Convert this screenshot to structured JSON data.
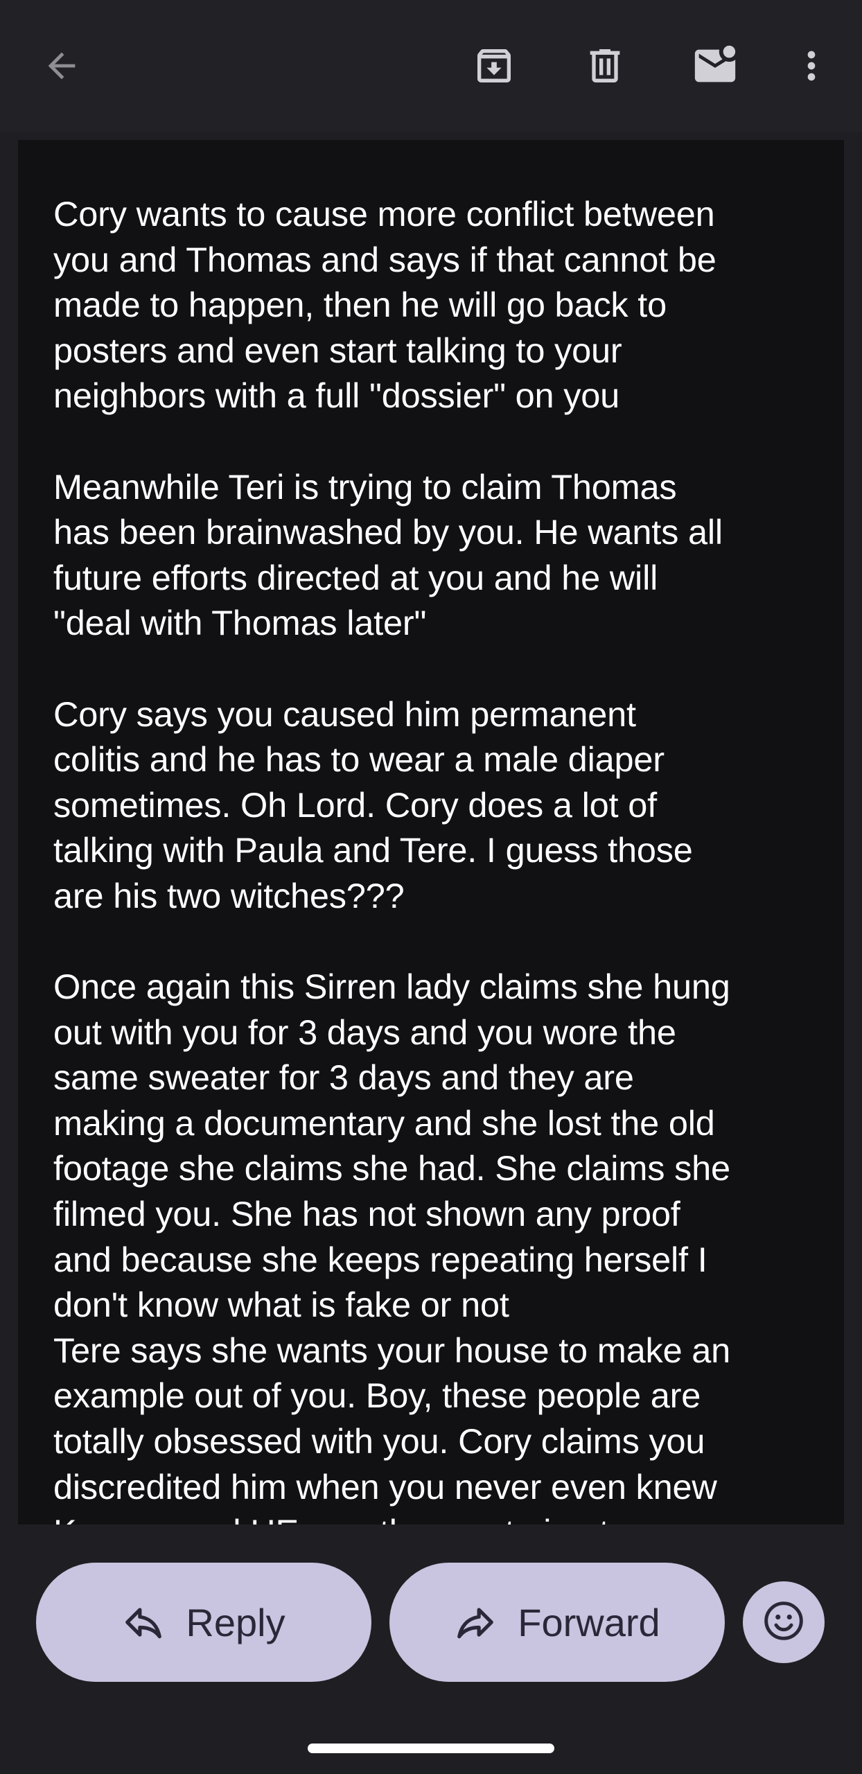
{
  "toolbar": {
    "icons": [
      "arrow-back-icon",
      "archive-icon",
      "trash-icon",
      "mark-unread-icon",
      "more-vert-icon"
    ]
  },
  "email": {
    "paragraphs": [
      "Cory wants to cause more conflict between\nyou and Thomas and says if that cannot be\nmade to happen, then he will go back to\nposters and even start talking to your\nneighbors with a full \"dossier\" on you",
      "Meanwhile Teri is trying to claim Thomas\nhas been brainwashed by you. He wants all\nfuture efforts directed at you and he will\n\"deal with Thomas later\"",
      "Cory says you caused him permanent\ncolitis and he has to wear a male diaper\nsometimes. Oh Lord. Cory does a lot of\ntalking with Paula and Tere. I guess those\nare his two witches???",
      "Once again this Sirren lady claims she hung\nout with you for 3 days and you wore the\nsame sweater for 3 days and they are\nmaking a documentary and she lost the old\nfootage she claims she had. She claims she\nfilmed you. She has not shown any proof\nand because she keeps repeating herself I\ndon't know what is fake or not\nTere says she wants your house to make an\nexample out of you. Boy, these people are\ntotally obsessed with you. Cory claims you\ndiscredited him when you never even knew\nKeenan and HE was the one trying to"
    ]
  },
  "actions": {
    "reply_label": "Reply",
    "forward_label": "Forward"
  },
  "colors": {
    "background": "#1f1f23",
    "body_background": "#111114",
    "button_background": "#c9c4df",
    "icon": "#c7c7cc"
  }
}
